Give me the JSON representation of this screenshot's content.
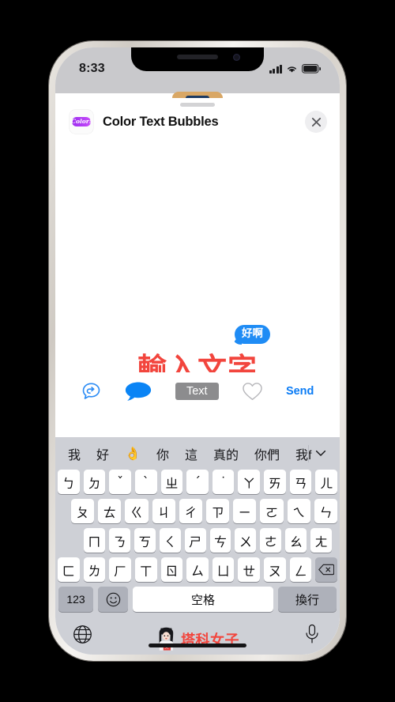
{
  "status_bar": {
    "time": "8:33",
    "signal_icon": "cellular-signal-icon",
    "wifi_icon": "wifi-icon",
    "battery_icon": "battery-icon"
  },
  "app_header": {
    "icon_label": "Color!",
    "title": "Color Text Bubbles",
    "close_icon": "close-icon"
  },
  "canvas": {
    "bubble_text": "好啊",
    "overlay_text": "輸入文字",
    "bubble_color": "#1f8cf5",
    "overlay_color": "#f2453d"
  },
  "toolbar": {
    "items": [
      {
        "name": "undo-bubble-icon",
        "label": ""
      },
      {
        "name": "bubble-fill-icon",
        "label": ""
      },
      {
        "name": "text-tool-button",
        "label": "Text"
      },
      {
        "name": "heart-outline-icon",
        "label": ""
      },
      {
        "name": "send-button",
        "label": "Send"
      }
    ],
    "text_label": "Text",
    "send_label": "Send",
    "accent_color": "#0b7cf5",
    "selected_color": "#8c8c8e"
  },
  "keyboard": {
    "predictive": {
      "items": [
        "我",
        "好",
        "👌",
        "你",
        "這",
        "真的",
        "你們",
        "我f"
      ],
      "more_icon": "chevron-down-icon"
    },
    "rows": [
      [
        "ㄅ",
        "ㄉ",
        "ˇ",
        "ˋ",
        "ㄓ",
        "ˊ",
        "˙",
        "ㄚ",
        "ㄞ",
        "ㄢ",
        "ㄦ"
      ],
      [
        "ㄆ",
        "ㄊ",
        "ㄍ",
        "ㄐ",
        "ㄔ",
        "ㄗ",
        "ㄧ",
        "ㄛ",
        "ㄟ",
        "ㄣ"
      ],
      [
        "ㄇ",
        "ㄋ",
        "ㄎ",
        "ㄑ",
        "ㄕ",
        "ㄘ",
        "ㄨ",
        "ㄜ",
        "ㄠ",
        "ㄤ"
      ],
      [
        "ㄈ",
        "ㄌ",
        "ㄏ",
        "ㄒ",
        "ㄖ",
        "ㄙ",
        "ㄩ",
        "ㄝ",
        "ㄡ",
        "ㄥ"
      ]
    ],
    "backspace_icon": "backspace-icon",
    "bottom_row": {
      "numeric_label": "123",
      "emoji_label": "☺",
      "space_label": "空格",
      "return_label": "換行"
    },
    "footer": {
      "globe_icon": "globe-icon",
      "mic_icon": "microphone-icon",
      "watermark_text": "塔科女子",
      "watermark_color": "#f2453d"
    }
  }
}
